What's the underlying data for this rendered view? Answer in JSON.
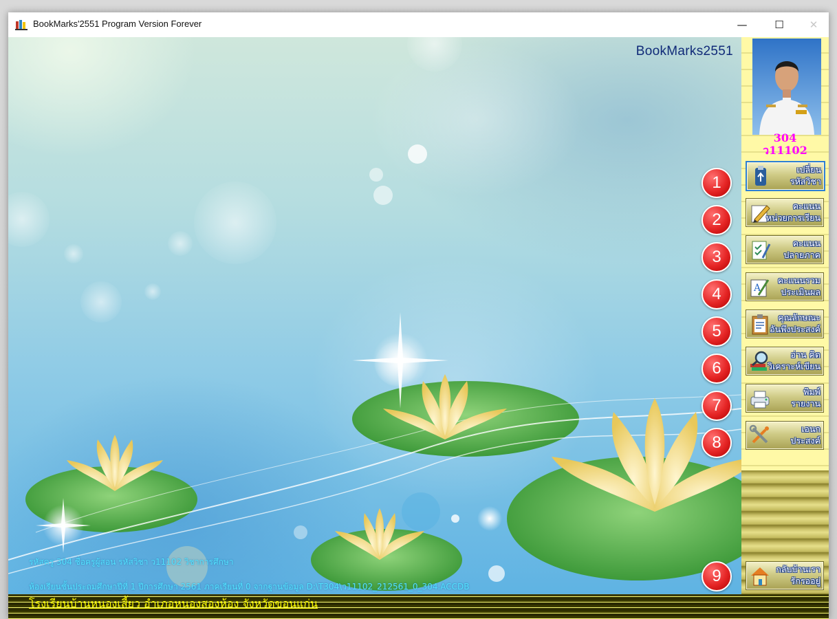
{
  "window": {
    "title": "BookMarks'2551 Program Version Forever",
    "controls": {
      "minimize": "—",
      "maximize": "☐",
      "close": "✕"
    }
  },
  "main": {
    "site_title": "BookMarks2551",
    "info_line_1": "รหัสครู 304  ชื่อครูผู้สอน  รหัสวิชา ว11102  วิชาการศึกษา",
    "info_line_2": "ห้องเรียนชั้นประถมศึกษาปีที่ 1  ปีการศึกษา 2561  ภาคเรียนที่  0  จากฐานข้อมูล D:\\T304\\ว11102_212561_0_304.ACCDB"
  },
  "sidebar": {
    "teacher_code": "304",
    "subject_code": "ว11102",
    "buttons": [
      {
        "number": "1",
        "line1": "เปลี่ยน",
        "line2": "รหัสวิชา",
        "icon": "usb-drive-icon"
      },
      {
        "number": "2",
        "line1": "คะแนน",
        "line2": "หน่วยการเรียน",
        "icon": "pencil-note-icon"
      },
      {
        "number": "3",
        "line1": "คะแนน",
        "line2": "ปลายภาค",
        "icon": "checklist-pen-icon"
      },
      {
        "number": "4",
        "line1": "คะแนนรวม",
        "line2": "ประเมินผล",
        "icon": "evaluation-icon"
      },
      {
        "number": "5",
        "line1": "คุณลักษณะ",
        "line2": "อันพึงประสงค์",
        "icon": "clipboard-icon"
      },
      {
        "number": "6",
        "line1": "อ่าน คิด",
        "line2": "วิเคราะห์เขียน",
        "icon": "magnifier-books-icon"
      },
      {
        "number": "7",
        "line1": "พิมพ์",
        "line2": "รายงาน",
        "icon": "printer-icon"
      },
      {
        "number": "8",
        "line1": "เอนก",
        "line2": "ประสงค์",
        "icon": "tools-icon"
      },
      {
        "number": "9",
        "line1": "กลับบ้านเรา",
        "line2": "รักรออยู่",
        "icon": "home-icon"
      }
    ]
  },
  "footer": {
    "school": "โรงเรียนบ้านหนองเสี้ยว  อำเภอหนองสองห้อง  จังหวัดขอนแก่น"
  }
}
